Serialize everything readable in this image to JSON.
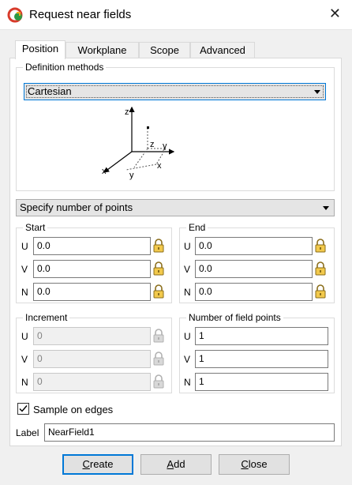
{
  "window": {
    "title": "Request near fields",
    "icon": "app-logo-icon",
    "close": "close-icon"
  },
  "tabs": [
    {
      "label": "Position",
      "active": true
    },
    {
      "label": "Workplane",
      "active": false
    },
    {
      "label": "Scope",
      "active": false
    },
    {
      "label": "Advanced",
      "active": false
    }
  ],
  "definition": {
    "group_label": "Definition methods",
    "method_value": "Cartesian",
    "diagram_labels": {
      "z_axis": "z",
      "x_axis": "x",
      "y_axis": "y",
      "z_local": "z",
      "x_local": "x",
      "y_local": "y"
    }
  },
  "points_mode": {
    "value": "Specify number of points"
  },
  "start": {
    "group_label": "Start",
    "rows": [
      {
        "label": "U",
        "value": "0.0"
      },
      {
        "label": "V",
        "value": "0.0"
      },
      {
        "label": "N",
        "value": "0.0"
      }
    ]
  },
  "end": {
    "group_label": "End",
    "rows": [
      {
        "label": "U",
        "value": "0.0"
      },
      {
        "label": "V",
        "value": "0.0"
      },
      {
        "label": "N",
        "value": "0.0"
      }
    ]
  },
  "increment": {
    "group_label": "Increment",
    "rows": [
      {
        "label": "U",
        "value": "0"
      },
      {
        "label": "V",
        "value": "0"
      },
      {
        "label": "N",
        "value": "0"
      }
    ]
  },
  "field_points": {
    "group_label": "Number of field points",
    "rows": [
      {
        "label": "U",
        "value": "1"
      },
      {
        "label": "V",
        "value": "1"
      },
      {
        "label": "N",
        "value": "1"
      }
    ]
  },
  "sample_on_edges": {
    "label": "Sample on edges",
    "checked": true
  },
  "label_field": {
    "label": "Label",
    "value": "NearField1"
  },
  "buttons": {
    "create": {
      "mnemonic": "C",
      "rest": "reate"
    },
    "add": {
      "mnemonic": "A",
      "rest": "dd"
    },
    "close": {
      "mnemonic": "C",
      "rest": "lose"
    }
  },
  "colors": {
    "accent": "#0078d7",
    "lock_fill": "#f2c94c",
    "lock_fill_disabled": "#d8d8d8"
  }
}
